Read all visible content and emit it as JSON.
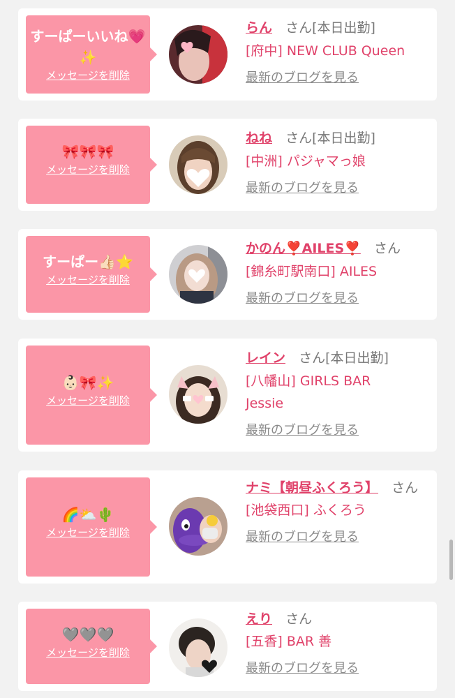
{
  "items": [
    {
      "message": "すーぱーいいね💗✨",
      "message_line1": "すーぱーいいね💗",
      "message_line2": "✨",
      "delete_label": "メッセージを削除",
      "name": "らん",
      "suffix": "さん[本日出勤]",
      "shop": "[府中] NEW CLUB Queen",
      "blog_label": "最新のブログを見る"
    },
    {
      "message": "🎀🎀🎀",
      "delete_label": "メッセージを削除",
      "name": "ねね",
      "suffix": "さん[本日出勤]",
      "shop": "[中洲] パジャマっ娘",
      "blog_label": "最新のブログを見る"
    },
    {
      "message": "すーぱー👍🏻⭐️",
      "delete_label": "メッセージを削除",
      "name": "かのん❣️AILES❣️",
      "suffix": "さん",
      "shop": "[錦糸町駅南口] AILES",
      "blog_label": "最新のブログを見る"
    },
    {
      "message": "👶🏻🎀✨",
      "delete_label": "メッセージを削除",
      "name": "レイン",
      "suffix": "さん[本日出勤]",
      "shop_line1": "[八幡山] GIRLS BAR",
      "shop_line2": "Jessie",
      "blog_label": "最新のブログを見る"
    },
    {
      "message": "🌈⛅️🌵",
      "delete_label": "メッセージを削除",
      "name": "ナミ【朝昼ふくろう】",
      "suffix": "さん",
      "shop": "[池袋西口] ふくろう",
      "blog_label": "最新のブログを見る"
    },
    {
      "message": "🩶🩶🩶",
      "delete_label": "メッセージを削除",
      "name": "えり",
      "suffix": "さん",
      "shop": "[五香] BAR 善",
      "blog_label": "最新のブログを見る"
    }
  ]
}
